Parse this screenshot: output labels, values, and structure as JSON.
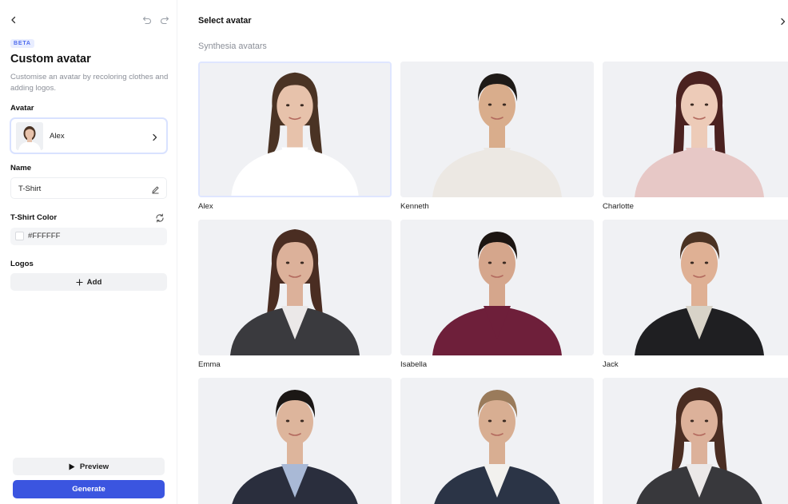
{
  "left_panel": {
    "badge": "BETA",
    "title": "Custom avatar",
    "description": "Customise an avatar by recoloring clothes and adding logos.",
    "avatar_label": "Avatar",
    "avatar_selected": "Alex",
    "name_label": "Name",
    "name_value": "T-Shirt",
    "color_label": "T-Shirt Color",
    "color_value": "#FFFFFF",
    "logos_label": "Logos",
    "add_label": "Add",
    "preview_label": "Preview",
    "generate_label": "Generate"
  },
  "right_panel": {
    "title": "Select avatar",
    "section": "Synthesia avatars",
    "avatars": [
      {
        "name": "Alex",
        "skin": "#e7c2ab",
        "hair": "#4a3324",
        "clothes": "#ffffff",
        "shirt": "#ffffff",
        "selected": true
      },
      {
        "name": "Kenneth",
        "skin": "#d9ad8c",
        "hair": "#1e1a17",
        "clothes": "#ece8e3",
        "shirt": "#ece8e3",
        "selected": false
      },
      {
        "name": "Charlotte",
        "skin": "#edcbb8",
        "hair": "#4b2220",
        "clothes": "#e7c8c6",
        "shirt": "#e7c8c6",
        "selected": false
      },
      {
        "name": "Emma",
        "skin": "#dcb19a",
        "hair": "#4a2d22",
        "clothes": "#3a3a3e",
        "shirt": "#ebe8e8",
        "selected": false
      },
      {
        "name": "Isabella",
        "skin": "#d5a68c",
        "hair": "#1c1512",
        "clothes": "#6e1f3a",
        "shirt": "#6e1f3a",
        "selected": false
      },
      {
        "name": "Jack",
        "skin": "#dfb094",
        "hair": "#4b3223",
        "clothes": "#1f1f22",
        "shirt": "#d8d3c8",
        "selected": false
      },
      {
        "name": "",
        "skin": "#ddb59c",
        "hair": "#1b1715",
        "clothes": "#2a2e3d",
        "shirt": "#a9b9d6",
        "selected": false
      },
      {
        "name": "",
        "skin": "#d8ae92",
        "hair": "#9a7b5b",
        "clothes": "#2b3446",
        "shirt": "#f2f1ee",
        "selected": false
      },
      {
        "name": "",
        "skin": "#dcb19a",
        "hair": "#4a2d22",
        "clothes": "#38383c",
        "shirt": "#ebe8e8",
        "selected": false
      }
    ]
  }
}
